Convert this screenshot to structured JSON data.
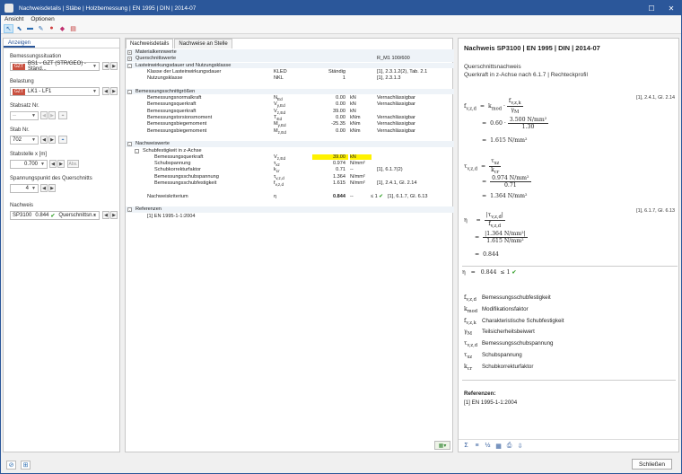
{
  "window": {
    "title": "Nachweisdetails | Stäbe | Holzbemessung | EN 1995 | DIN | 2014-07"
  },
  "menu": [
    "Ansicht",
    "Optionen"
  ],
  "left": {
    "tab": "Anzeigen",
    "bemessungssituation_label": "Bemessungssituation",
    "bemessungssituation_badge": "GZT",
    "bemessungssituation_value": "BS1 - GZT (STR/GEO) - Ständ...",
    "belastung_label": "Belastung",
    "belastung_badge": "GZT",
    "belastung_value": "LK1 - LF1",
    "stabsatz_label": "Stabsatz Nr.",
    "stabsatz_value": "--",
    "stab_label": "Stab Nr.",
    "stab_value": "702",
    "stabstelle_label": "Stabstelle x [m]",
    "stabstelle_value": "0.700",
    "stabstelle_btn": "Abs.",
    "spannungspunkt_label": "Spannungspunkt des Querschnitts",
    "spannungspunkt_value": "4",
    "nachweis_label": "Nachweis",
    "nachweis_id": "SP3100",
    "nachweis_ratio": "0.844",
    "nachweis_type": "Querschnittsn..."
  },
  "center": {
    "tabs": [
      "Nachweisdetails",
      "Nachweise an Stelle"
    ],
    "rows": [
      {
        "level": 0,
        "exp": "+",
        "name": "Materialkennwerte",
        "sym": "",
        "val": "",
        "unit": "",
        "ref": "",
        "hdr": true
      },
      {
        "level": 0,
        "exp": "+",
        "name": "Querschnittswerte",
        "sym": "",
        "val": "",
        "unit": "",
        "ref": "R_M1 100/600",
        "hdr": true
      },
      {
        "level": 0,
        "exp": "-",
        "name": "Lasteinwirkungsdauer und Nutzungsklasse",
        "sym": "",
        "val": "",
        "unit": "",
        "ref": "",
        "hdr": true
      },
      {
        "level": 1,
        "exp": "",
        "name": "Klasse der Lasteinwirkungsdauer",
        "sym": "KLED",
        "val": "Ständig",
        "unit": "",
        "ref": "[1], 2.3.1.2(2), Tab. 2.1"
      },
      {
        "level": 1,
        "exp": "",
        "name": "Nutzungsklasse",
        "sym": "NKL",
        "val": "1",
        "unit": "",
        "ref": "[1], 2.3.1.3"
      },
      {
        "level": 0,
        "exp": "",
        "name": "",
        "sym": "",
        "val": "",
        "unit": "",
        "ref": ""
      },
      {
        "level": 0,
        "exp": "-",
        "name": "Bemessungsschnittgrößen",
        "sym": "",
        "val": "",
        "unit": "",
        "ref": "",
        "hdr": true
      },
      {
        "level": 1,
        "exp": "",
        "name": "Bemessungsnormalkraft",
        "sym": "N_Ed",
        "val": "0.00",
        "unit": "kN",
        "ref": "Vernachlässigbar"
      },
      {
        "level": 1,
        "exp": "",
        "name": "Bemessungsquerkraft",
        "sym": "V_y,Ed",
        "val": "0.00",
        "unit": "kN",
        "ref": "Vernachlässigbar"
      },
      {
        "level": 1,
        "exp": "",
        "name": "Bemessungsquerkraft",
        "sym": "V_z,Ed",
        "val": "39.00",
        "unit": "kN",
        "ref": ""
      },
      {
        "level": 1,
        "exp": "",
        "name": "Bemessungstorsionsmoment",
        "sym": "T_Ed",
        "val": "0.00",
        "unit": "kNm",
        "ref": "Vernachlässigbar"
      },
      {
        "level": 1,
        "exp": "",
        "name": "Bemessungsbiegemoment",
        "sym": "M_y,Ed",
        "val": "-25.35",
        "unit": "kNm",
        "ref": "Vernachlässigbar"
      },
      {
        "level": 1,
        "exp": "",
        "name": "Bemessungsbiegemoment",
        "sym": "M_z,Ed",
        "val": "0.00",
        "unit": "kNm",
        "ref": "Vernachlässigbar"
      },
      {
        "level": 0,
        "exp": "",
        "name": "",
        "sym": "",
        "val": "",
        "unit": "",
        "ref": ""
      },
      {
        "level": 0,
        "exp": "-",
        "name": "Nachweiswerte",
        "sym": "",
        "val": "",
        "unit": "",
        "ref": "",
        "hdr": true
      },
      {
        "level": 1,
        "exp": "-",
        "name": "Schubfestigkeit in z-Achse",
        "sym": "",
        "val": "",
        "unit": "",
        "ref": ""
      },
      {
        "level": 2,
        "exp": "",
        "name": "Bemessungsquerkraft",
        "sym": "V_z,Ed",
        "val": "39.00",
        "unit": "kN",
        "ref": "",
        "yel": true
      },
      {
        "level": 2,
        "exp": "",
        "name": "Schubspannung",
        "sym": "τ_xz",
        "val": "0.974",
        "unit": "N/mm²",
        "ref": ""
      },
      {
        "level": 2,
        "exp": "",
        "name": "Schubkorrekturfaktor",
        "sym": "k_cr",
        "val": "0.71",
        "unit": "--",
        "ref": "[1], 6.1.7(2)"
      },
      {
        "level": 2,
        "exp": "",
        "name": "Bemessungsschubspannung",
        "sym": "τ_v,z,d",
        "val": "1.364",
        "unit": "N/mm²",
        "ref": ""
      },
      {
        "level": 2,
        "exp": "",
        "name": "Bemessungsschubfestigkeit",
        "sym": "f_v,z,d",
        "val": "1.615",
        "unit": "N/mm²",
        "ref": "[1], 2.4.1, Gl. 2.14"
      },
      {
        "level": 0,
        "exp": "",
        "name": "",
        "sym": "",
        "val": "",
        "unit": "",
        "ref": ""
      },
      {
        "level": 1,
        "exp": "",
        "name": "Nachweiskriterium",
        "sym": "η",
        "val": "0.844",
        "unit": "--",
        "ref": "[1], 6.1.7, Gl. 6.13",
        "le": "≤ 1",
        "bold": true
      },
      {
        "level": 0,
        "exp": "",
        "name": "",
        "sym": "",
        "val": "",
        "unit": "",
        "ref": ""
      },
      {
        "level": 0,
        "exp": "-",
        "name": "Referenzen",
        "sym": "",
        "val": "",
        "unit": "",
        "ref": "",
        "hdr": true
      },
      {
        "level": 1,
        "exp": "",
        "name": "[1]   EN 1995-1-1:2004",
        "sym": "",
        "val": "",
        "unit": "",
        "ref": ""
      }
    ]
  },
  "right": {
    "title": "Nachweis SP3100 | EN 1995 | DIN | 2014-07",
    "sub1": "Querschnittsnachweis",
    "sub2": "Querkraft in z-Achse nach 6.1.7 | Rechteckprofil",
    "ref1": "[1], 2.4.1, Gl. 2.14",
    "ref2": "[1], 6.1.7, Gl. 6.13",
    "legend": [
      {
        "sym": "f_v,z,d",
        "text": "Bemessungsschubfestigkeit"
      },
      {
        "sym": "k_mod",
        "text": "Modifikationsfaktor"
      },
      {
        "sym": "f_v,z,k",
        "text": "Charakteristische Schubfestigkeit"
      },
      {
        "sym": "γ_M",
        "text": "Teilsicherheitsbeiwert"
      },
      {
        "sym": "τ_v,z,d",
        "text": "Bemessungsschubspannung"
      },
      {
        "sym": "τ_xz",
        "text": "Schubspannung"
      },
      {
        "sym": "k_cr",
        "text": "Schubkorrekturfaktor"
      }
    ],
    "ref_heading": "Referenzen:",
    "ref_item": "[1]   EN 1995-1-1:2004"
  },
  "footer": {
    "close": "Schließen"
  }
}
